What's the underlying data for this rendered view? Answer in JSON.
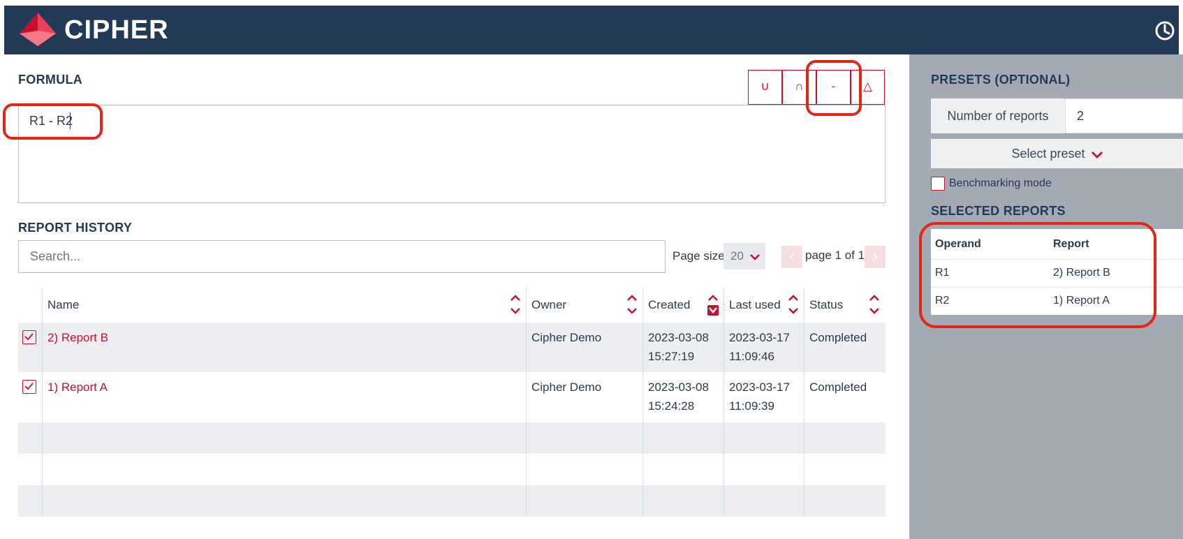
{
  "app": {
    "title": "CIPHER"
  },
  "formula": {
    "title": "FORMULA",
    "value": "R1 - R2",
    "operators": [
      {
        "label": "∪",
        "name": "union"
      },
      {
        "label": "∩",
        "name": "intersection"
      },
      {
        "label": "-",
        "name": "difference"
      },
      {
        "label": "△",
        "name": "symmetric-difference"
      }
    ]
  },
  "history": {
    "title": "REPORT HISTORY",
    "search_placeholder": "Search...",
    "page_size_label": "Page size",
    "page_size_value": "20",
    "page_indicator": "page 1 of 1",
    "columns": [
      "Name",
      "Owner",
      "Created",
      "Last used",
      "Status"
    ],
    "rows": [
      {
        "name": "2) Report B",
        "owner": "Cipher Demo",
        "created_date": "2023-03-08",
        "created_time": "15:27:19",
        "last_used_date": "2023-03-17",
        "last_used_time": "11:09:46",
        "status": "Completed",
        "checked": true
      },
      {
        "name": "1) Report A",
        "owner": "Cipher Demo",
        "created_date": "2023-03-08",
        "created_time": "15:24:28",
        "last_used_date": "2023-03-17",
        "last_used_time": "11:09:39",
        "status": "Completed",
        "checked": true
      }
    ]
  },
  "presets": {
    "title": "PRESETS (OPTIONAL)",
    "num_reports_label": "Number of reports",
    "num_reports_value": "2",
    "select_preset_label": "Select preset",
    "benchmarking_label": "Benchmarking mode"
  },
  "selected": {
    "title": "SELECTED REPORTS",
    "columns": [
      "Operand",
      "Report"
    ],
    "rows": [
      {
        "operand": "R1",
        "report": "2) Report B"
      },
      {
        "operand": "R2",
        "report": "1) Report A"
      }
    ]
  },
  "colors": {
    "header_bg": "#233a56",
    "accent": "#c8102e",
    "panel_bg": "#a3aab3",
    "highlight": "#e3261a"
  }
}
